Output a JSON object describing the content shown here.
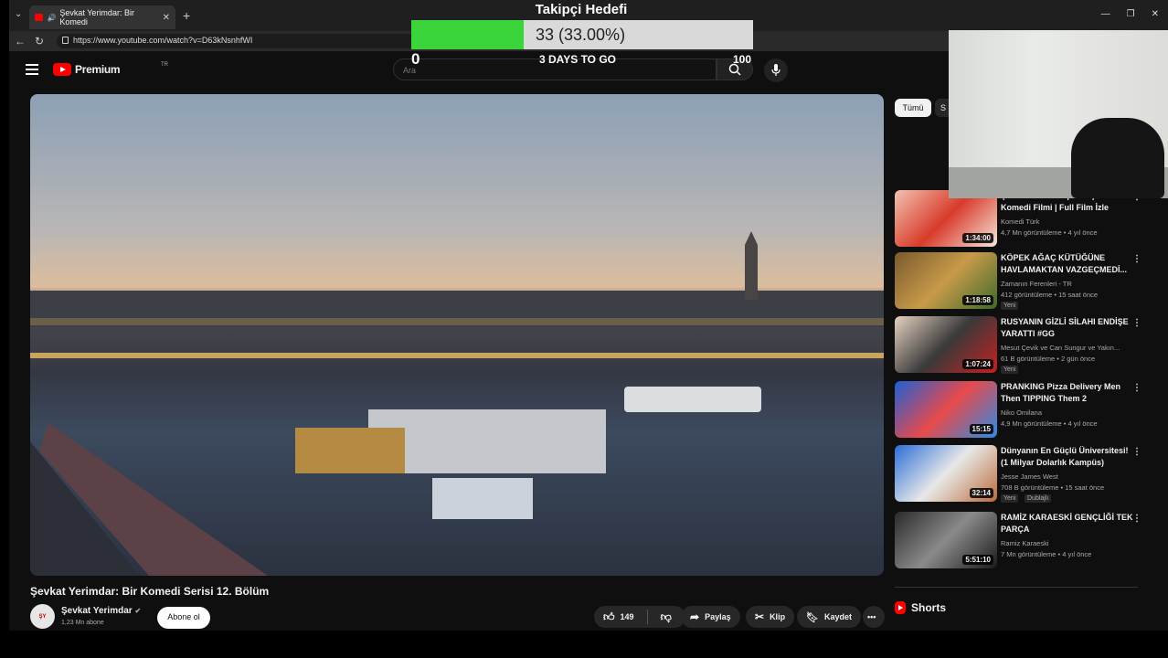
{
  "browser": {
    "tab_title": "Şevkat Yerimdar: Bir Komedi",
    "url": "https://www.youtube.com/watch?v=D63kNsnhfWI"
  },
  "youtube": {
    "logo_text": "Premium",
    "logo_country": "TR",
    "search_placeholder": "Ara"
  },
  "goal": {
    "title": "Takipçi Hedefi",
    "progress_text": "33 (33.00%)",
    "progress_fraction": 0.33,
    "min": "0",
    "max": "100",
    "days": "3 DAYS TO GO",
    "fill_color": "#3bd43b"
  },
  "video": {
    "title": "Şevkat Yerimdar: Bir Komedi Serisi 12. Bölüm",
    "channel": "Şevkat Yerimdar",
    "subscribers": "1,23 Mn abone",
    "subscribe_label": "Abone ol",
    "likes": "149",
    "share_label": "Paylaş",
    "clip_label": "Klip",
    "save_label": "Kaydet"
  },
  "sidebar": {
    "chip_all": "Tümü",
    "chip_next": "S",
    "shorts_label": "Shorts",
    "items": [
      {
        "title": "Şevkat Yerimdar | 2013 | Yerli Komedi Filmi | Full Film İzle",
        "channel": "Komedi Türk",
        "stats": "4,7 Mn görüntüleme • 4 yıl önce",
        "duration": "1:34:00",
        "badges": []
      },
      {
        "title": "KÖPEK AĞAÇ KÜTÜĞÜNE HAVLAMAKTAN VAZGEÇMEDİ...",
        "channel": "Zamanın Ferenleri - TR",
        "stats": "412 görüntüleme • 15 saat önce",
        "duration": "1:18:58",
        "badges": [
          "Yeni"
        ]
      },
      {
        "title": "RUSYANIN GİZLİ SİLAHI ENDİŞE YARATTI #GG",
        "channel": "Mesut Çevik ve Can Sungur ve Yakın...",
        "stats": "61 B görüntüleme • 2 gün önce",
        "duration": "1:07:24",
        "badges": [
          "Yeni"
        ]
      },
      {
        "title": "PRANKING Pizza Delivery Men Then TIPPING Them 2",
        "channel": "Niko Omilana",
        "stats": "4,9 Mn görüntüleme • 4 yıl önce",
        "duration": "15:15",
        "badges": []
      },
      {
        "title": "Dünyanın En Güçlü Üniversitesi! (1 Milyar Dolarlık Kampüs)",
        "channel": "Jesse James West",
        "stats": "708 B görüntüleme • 15 saat önce",
        "duration": "32:14",
        "badges": [
          "Yeni",
          "Dublajlı"
        ]
      },
      {
        "title": "RAMİZ KARAESKİ GENÇLİĞİ TEK PARÇA",
        "channel": "Ramiz Karaeski",
        "stats": "7 Mn görüntüleme • 4 yıl önce",
        "duration": "5:51:10",
        "badges": []
      }
    ]
  }
}
